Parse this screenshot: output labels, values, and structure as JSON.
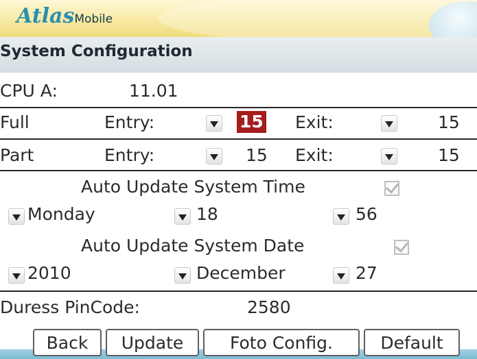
{
  "app": {
    "logo_main": "Atlas",
    "logo_sub": "Mobile"
  },
  "screen_title": "System Configuration",
  "cpu": {
    "label": "CPU A:",
    "value": "11.01"
  },
  "full": {
    "label": "Full",
    "entry_label": "Entry:",
    "entry_value": "15",
    "exit_label": "Exit:",
    "exit_value": "15"
  },
  "part": {
    "label": "Part",
    "entry_label": "Entry:",
    "entry_value": "15",
    "exit_label": "Exit:",
    "exit_value": "15"
  },
  "auto_time": {
    "label": "Auto Update System Time",
    "checked": true,
    "day": "Monday",
    "hour": "18",
    "minute": "56"
  },
  "auto_date": {
    "label": "Auto Update System Date",
    "checked": true,
    "year": "2010",
    "month": "December",
    "day": "27"
  },
  "duress": {
    "label": "Duress PinCode:",
    "value": "2580"
  },
  "buttons": {
    "back": "Back",
    "update": "Update",
    "foto_config": "Foto Config.",
    "default": "Default"
  },
  "colors": {
    "accent_logo": "#2a8fb0",
    "focus_highlight": "#a51d1d",
    "header_gold": "#f1dc80"
  },
  "icons": {
    "dropdown": "dropdown-arrow-icon",
    "checkbox": "checkbox-checked-icon"
  }
}
